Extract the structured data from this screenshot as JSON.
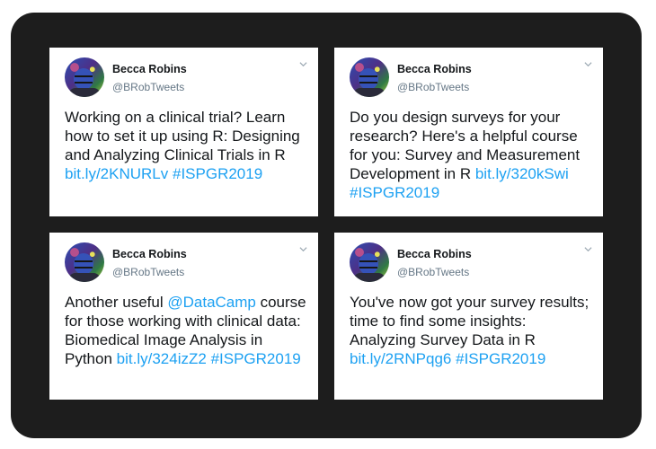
{
  "tweets": [
    {
      "name": "Becca Robins",
      "handle": "@BRobTweets",
      "segments": [
        {
          "text": "Working on a clinical trial? Learn how to set it up using R: Designing and Analyzing Clinical Trials in R ",
          "link": false
        },
        {
          "text": "bit.ly/2KNURLv",
          "link": true
        },
        {
          "text": " ",
          "link": false
        },
        {
          "text": "#ISPGR2019",
          "link": true
        }
      ]
    },
    {
      "name": "Becca Robins",
      "handle": "@BRobTweets",
      "segments": [
        {
          "text": "Do you design surveys for your research? Here's a helpful course for you: Survey and Measurement Development in R ",
          "link": false
        },
        {
          "text": "bit.ly/320kSwi",
          "link": true
        },
        {
          "text": " ",
          "link": false
        },
        {
          "text": "#ISPGR2019",
          "link": true
        }
      ]
    },
    {
      "name": "Becca Robins",
      "handle": "@BRobTweets",
      "segments": [
        {
          "text": "Another useful ",
          "link": false
        },
        {
          "text": "@DataCamp",
          "link": true
        },
        {
          "text": " course for those working with clinical data: Biomedical Image Analysis in Python ",
          "link": false
        },
        {
          "text": "bit.ly/324izZ2",
          "link": true
        },
        {
          "text": " ",
          "link": false
        },
        {
          "text": "#ISPGR2019",
          "link": true
        }
      ]
    },
    {
      "name": "Becca Robins",
      "handle": "@BRobTweets",
      "segments": [
        {
          "text": "You've now got your survey results; time to find some insights: Analyzing Survey Data in R ",
          "link": false
        },
        {
          "text": "bit.ly/2RNPqg6",
          "link": true
        },
        {
          "text": " ",
          "link": false
        },
        {
          "text": "#ISPGR2019",
          "link": true
        }
      ]
    }
  ],
  "colors": {
    "frame": "#1d1d1d",
    "link": "#1da1f2",
    "handle": "#657786",
    "text": "#14171a"
  },
  "icons": {
    "avatar": "profile-photo",
    "menu": "chevron-down-icon"
  }
}
